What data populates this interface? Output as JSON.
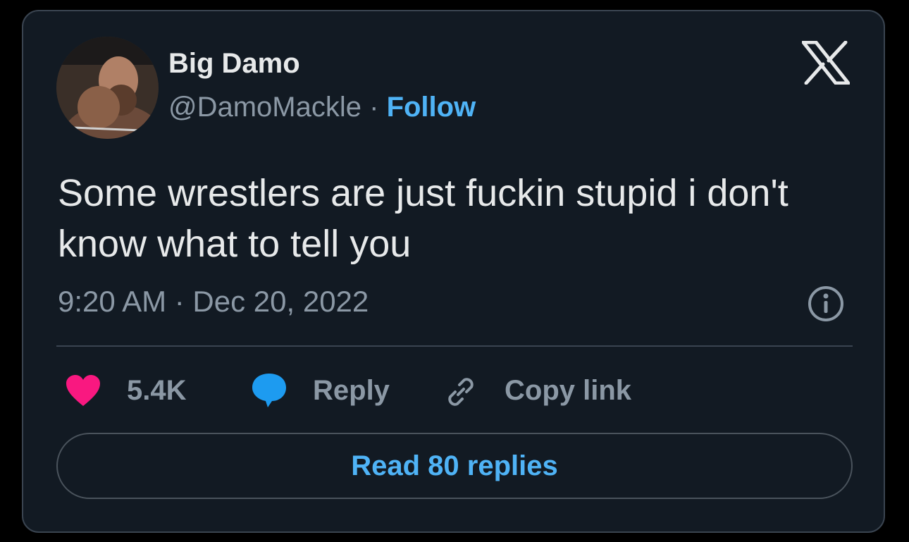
{
  "author": {
    "display_name": "Big Damo",
    "handle": "@DamoMackle",
    "separator": " · ",
    "follow_label": "Follow"
  },
  "tweet": {
    "text": "Some wrestlers are just fuckin stupid i don't know what to tell you",
    "timestamp": "9:20 AM · Dec 20, 2022"
  },
  "actions": {
    "likes_count": "5.4K",
    "reply_label": "Reply",
    "copy_link_label": "Copy link"
  },
  "footer": {
    "read_replies_label": "Read 80 replies"
  },
  "icons": {
    "brand": "x-logo-icon",
    "info": "info-icon",
    "like": "heart-icon",
    "reply": "speech-bubble-icon",
    "copy": "link-icon"
  },
  "colors": {
    "card_bg": "#121a23",
    "accent": "#4fb3f6",
    "heart": "#f91880",
    "reply_bubble": "#1d9bf0",
    "muted": "#8b98a5",
    "text": "#e7e9ea"
  }
}
